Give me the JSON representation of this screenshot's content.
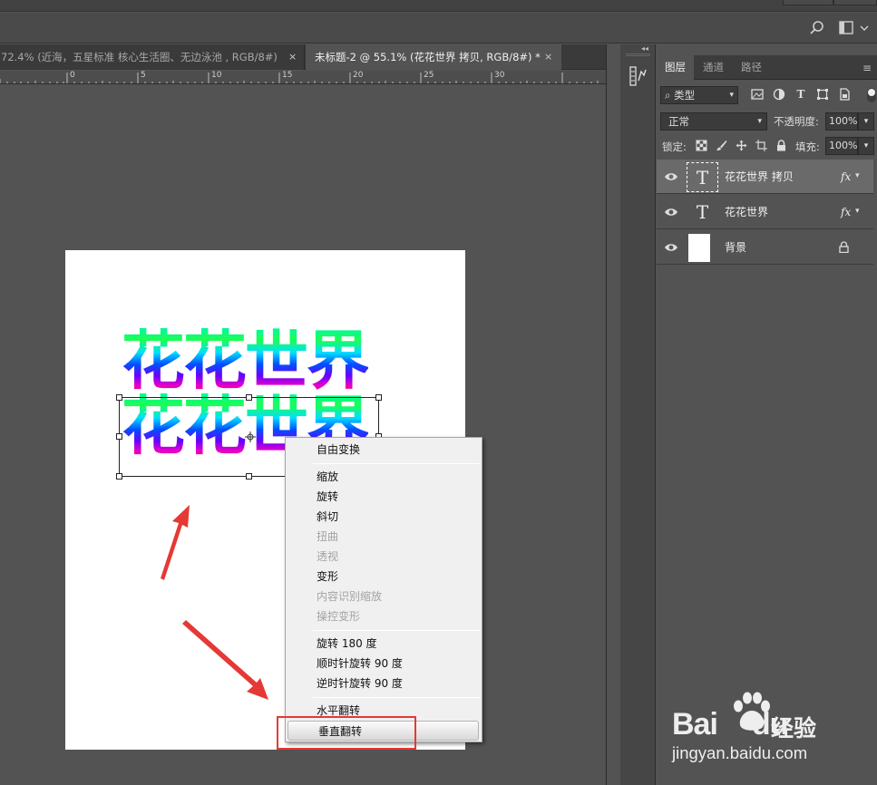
{
  "tabs": {
    "inactive_label": "72.4% (近海，五星标准 核心生活圈、无边泳池 , RGB/8#)",
    "active_label": "未标题-2 @ 55.1% (花花世界 拷贝, RGB/8#) *",
    "close_glyph": "×"
  },
  "ruler": {
    "labels": [
      "0",
      "5",
      "10",
      "15",
      "20",
      "25",
      "30"
    ]
  },
  "canvas": {
    "line1": "花花世界",
    "line2": "花花世界"
  },
  "context_menu": {
    "items": [
      {
        "label": "自由变换",
        "enabled": true
      },
      {
        "label": "缩放",
        "enabled": true
      },
      {
        "label": "旋转",
        "enabled": true
      },
      {
        "label": "斜切",
        "enabled": true
      },
      {
        "label": "扭曲",
        "enabled": false
      },
      {
        "label": "透视",
        "enabled": false
      },
      {
        "label": "变形",
        "enabled": true
      },
      {
        "label": "内容识别缩放",
        "enabled": false
      },
      {
        "label": "操控变形",
        "enabled": false
      },
      {
        "label": "旋转 180 度",
        "enabled": true
      },
      {
        "label": "顺时针旋转 90 度",
        "enabled": true
      },
      {
        "label": "逆时针旋转 90 度",
        "enabled": true
      },
      {
        "label": "水平翻转",
        "enabled": true
      },
      {
        "label": "垂直翻转",
        "enabled": true,
        "highlighted": true
      }
    ]
  },
  "layers_panel": {
    "tabs": [
      "图层",
      "通道",
      "路径"
    ],
    "active_tab": "图层",
    "filter_label": "类型",
    "filter_icon_glyph": "⌕",
    "blend_mode": "正常",
    "opacity_label": "不透明度:",
    "opacity_value": "100%",
    "lock_label": "锁定:",
    "fill_label": "填充:",
    "fill_value": "100%",
    "layers": [
      {
        "name": "花花世界 拷贝",
        "type": "text",
        "fx": "fx",
        "selected": true
      },
      {
        "name": "花花世界",
        "type": "text",
        "fx": "fx",
        "selected": false
      },
      {
        "name": "背景",
        "type": "background",
        "locked": true,
        "selected": false
      }
    ],
    "thumb_glyph": "T"
  },
  "watermark": {
    "brand": "Bai",
    "brand2": "du",
    "cn": "经验",
    "url": "jingyan.baidu.com"
  },
  "colors": {
    "annotation": "#e53935",
    "panel_bg": "#535353"
  }
}
